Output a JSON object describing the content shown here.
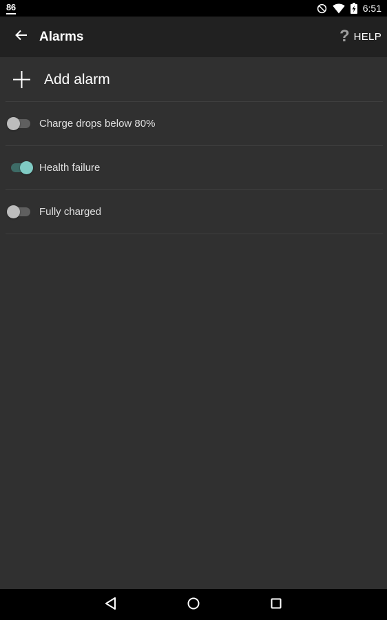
{
  "status_bar": {
    "notification_number": "86",
    "time": "6:51",
    "icons": [
      "do-not-disturb-icon",
      "wifi-icon",
      "battery-charging-icon"
    ]
  },
  "app_bar": {
    "title": "Alarms",
    "back_icon": "arrow-back-icon",
    "help_icon": "question-mark-icon",
    "help_label": "HELP"
  },
  "list": {
    "add_alarm": {
      "icon": "plus-icon",
      "label": "Add alarm"
    },
    "alarms": [
      {
        "label": "Charge drops below 80%",
        "enabled": false
      },
      {
        "label": "Health failure",
        "enabled": true
      },
      {
        "label": "Fully charged",
        "enabled": false
      }
    ]
  },
  "nav_bar": {
    "icons": [
      "nav-back-icon",
      "nav-home-icon",
      "nav-recents-icon"
    ]
  },
  "colors": {
    "background": "#303030",
    "app_bar": "#212121",
    "accent": "#80cbc4",
    "divider": "#3f3f3f"
  }
}
